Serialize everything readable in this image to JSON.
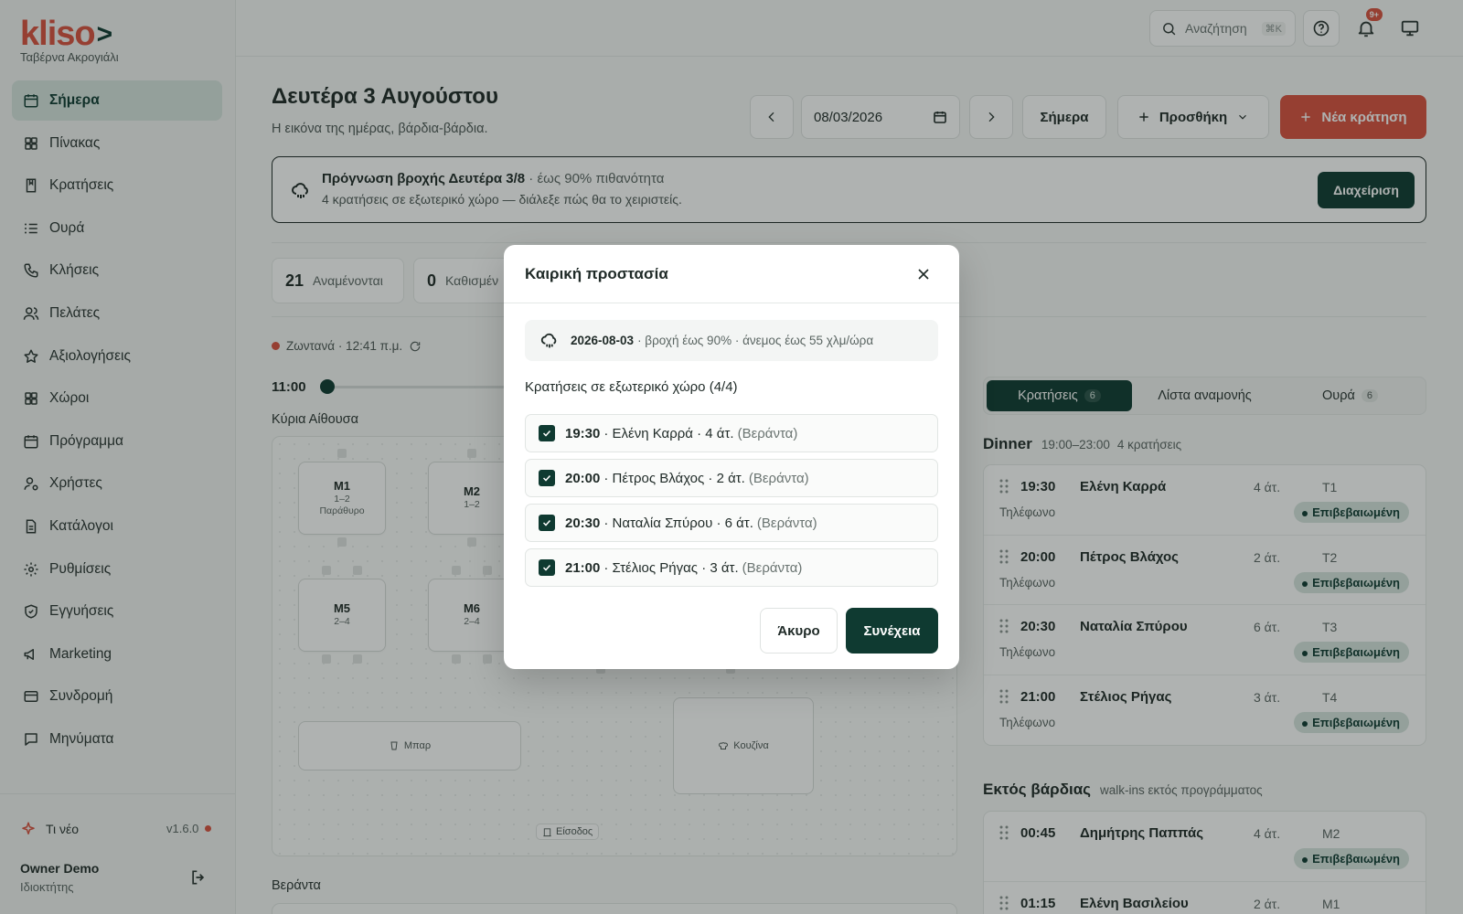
{
  "sidebar": {
    "logo_text": "kliso",
    "logo_chevron": ">",
    "restaurant": "Ταβέρνα Ακρογιάλι",
    "items": [
      {
        "label": "Σήμερα",
        "icon": "calendar-icon",
        "active": true
      },
      {
        "label": "Πίνακας",
        "icon": "grid-icon"
      },
      {
        "label": "Κρατήσεις",
        "icon": "book-icon"
      },
      {
        "label": "Ουρά",
        "icon": "list-icon"
      },
      {
        "label": "Κλήσεις",
        "icon": "phone-icon"
      },
      {
        "label": "Πελάτες",
        "icon": "users-icon"
      },
      {
        "label": "Αξιολογήσεις",
        "icon": "star-icon"
      },
      {
        "label": "Χώροι",
        "icon": "grid-icon"
      },
      {
        "label": "Πρόγραμμα",
        "icon": "calendar-icon"
      },
      {
        "label": "Χρήστες",
        "icon": "user-cog-icon"
      },
      {
        "label": "Κατάλογοι",
        "icon": "file-icon"
      },
      {
        "label": "Ρυθμίσεις",
        "icon": "gear-icon"
      },
      {
        "label": "Εγγυήσεις",
        "icon": "shield-icon"
      },
      {
        "label": "Marketing",
        "icon": "megaphone-icon"
      },
      {
        "label": "Συνδρομή",
        "icon": "card-icon"
      },
      {
        "label": "Μηνύματα",
        "icon": "message-icon"
      }
    ],
    "whats_new": "Τι νέο",
    "version": "v1.6.0",
    "user_name": "Owner Demo",
    "user_role": "Ιδιοκτήτης"
  },
  "topbar": {
    "search_placeholder": "Αναζήτηση",
    "search_kbd": "⌘K",
    "notifications_badge": "9+"
  },
  "header": {
    "title": "Δευτέρα 3 Αυγούστου",
    "subtitle": "Η εικόνα της ημέρας, βάρδια-βάρδια.",
    "date_value": "08/03/2026",
    "today_label": "Σήμερα",
    "add_label": "Προσθήκη",
    "new_label": "Νέα κράτηση"
  },
  "alert": {
    "title": "Πρόγνωση βροχής Δευτέρα 3/8",
    "title_extra": "· έως 90% πιθανότητα",
    "description": "4 κρατήσεις σε εξωτερικό χώρο — διάλεξε πώς θα το χειριστείς.",
    "action": "Διαχείριση"
  },
  "stats": [
    {
      "value": "21",
      "label": "Αναμένονται"
    },
    {
      "value": "0",
      "label": "Καθισμέν"
    }
  ],
  "live": {
    "label": "Ζωντανά",
    "time": "· 12:41 π.μ."
  },
  "timeline": {
    "time": "11:00"
  },
  "floor": {
    "area_main": "Κύρια Αίθουσα",
    "tables": [
      {
        "name": "M1",
        "capacity": "1–2",
        "note": "Παράθυρο"
      },
      {
        "name": "M2",
        "capacity": "1–2",
        "note": ""
      },
      {
        "name": "M5",
        "capacity": "2–4",
        "note": ""
      },
      {
        "name": "M6",
        "capacity": "2–4",
        "note": ""
      }
    ],
    "bar": "Μπαρ",
    "kitchen": "Κουζίνα",
    "entrance": "Είσοδος",
    "area_second": "Βεράντα"
  },
  "panel": {
    "tabs": [
      {
        "label": "Κρατήσεις",
        "count": "6",
        "active": true
      },
      {
        "label": "Λίστα αναμονής",
        "count": ""
      },
      {
        "label": "Ουρά",
        "count": "6"
      }
    ],
    "dinner": {
      "title": "Dinner",
      "hours": "19:00–23:00",
      "count": "4 κρατήσεις",
      "reservations": [
        {
          "time": "19:30",
          "name": "Ελένη Καρρά",
          "party": "4 άτ.",
          "table": "T1",
          "source": "Τηλέφωνο",
          "status": "Επιβεβαιωμένη"
        },
        {
          "time": "20:00",
          "name": "Πέτρος Βλάχος",
          "party": "2 άτ.",
          "table": "T2",
          "source": "Τηλέφωνο",
          "status": "Επιβεβαιωμένη"
        },
        {
          "time": "20:30",
          "name": "Ναταλία Σπύρου",
          "party": "6 άτ.",
          "table": "T3",
          "source": "Τηλέφωνο",
          "status": "Επιβεβαιωμένη"
        },
        {
          "time": "21:00",
          "name": "Στέλιος Ρήγας",
          "party": "3 άτ.",
          "table": "T4",
          "source": "Τηλέφωνο",
          "status": "Επιβεβαιωμένη"
        }
      ]
    },
    "off_shift": {
      "title": "Εκτός βάρδιας",
      "subtitle": "walk-ins εκτός προγράμματος",
      "reservations": [
        {
          "time": "00:45",
          "name": "Δημήτρης Παππάς",
          "party": "4 άτ.",
          "table": "M2",
          "source": "",
          "status": "Επιβεβαιωμένη"
        },
        {
          "time": "01:15",
          "name": "Ελένη Βασιλείου",
          "party": "2 άτ.",
          "table": "M1",
          "source": "",
          "status": ""
        }
      ]
    }
  },
  "modal": {
    "title": "Καιρική προστασία",
    "info_date": "2026-08-03",
    "info_text": "· βροχή έως 90% · άνεμος έως 55 χλμ/ώρα",
    "subtitle": "Κρατήσεις σε εξωτερικό χώρο (4/4)",
    "rows": [
      {
        "time": "19:30",
        "text": "· Ελένη Καρρά · 4 άτ.",
        "area": "(Βεράντα)",
        "checked": true
      },
      {
        "time": "20:00",
        "text": "· Πέτρος Βλάχος · 2 άτ.",
        "area": "(Βεράντα)",
        "checked": true
      },
      {
        "time": "20:30",
        "text": "· Ναταλία Σπύρου · 6 άτ.",
        "area": "(Βεράντα)",
        "checked": true
      },
      {
        "time": "21:00",
        "text": "· Στέλιος Ρήγας · 3 άτ.",
        "area": "(Βεράντα)",
        "checked": true
      }
    ],
    "cancel": "Άκυρο",
    "confirm": "Συνέχεια"
  },
  "colors": {
    "accent": "#d9513f",
    "primary": "#0f3a31",
    "active_bg": "#d6e4de"
  }
}
